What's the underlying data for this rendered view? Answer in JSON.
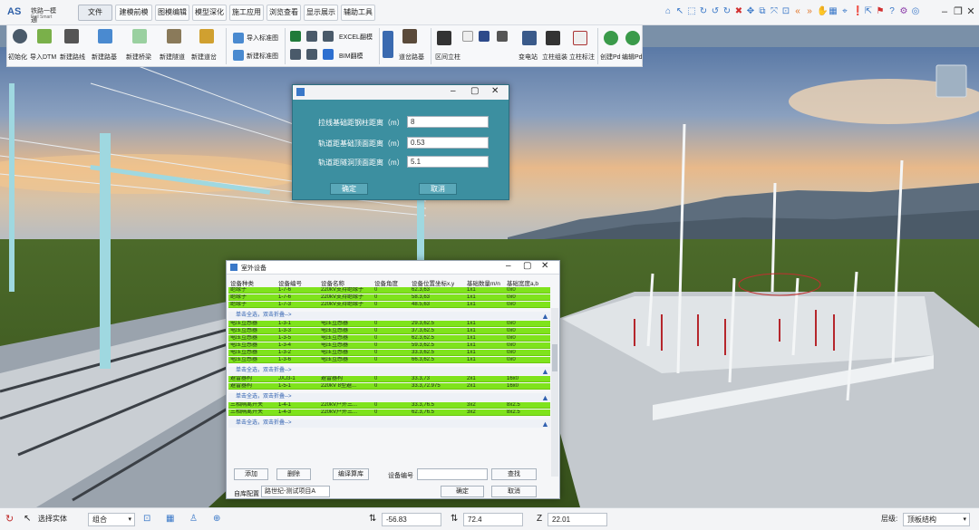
{
  "app": {
    "logo_mark": "AS",
    "logo_name": "铁路一模通",
    "logo_sub": "Rail Smart"
  },
  "menu": [
    "文件",
    "建模前模",
    "图模编辑",
    "模型深化",
    "施工应用",
    "浏览查看",
    "显示展示",
    "辅助工具"
  ],
  "ribbon": {
    "group1": [
      "初始化",
      "导入DTM",
      "新建路线",
      "新建路基",
      "新建桥梁",
      "新建隧道",
      "新建道岔"
    ],
    "group2": [
      "导入标准图",
      "新建标准图"
    ],
    "group3": [
      "EXCEL翻模",
      "BIM翻模"
    ],
    "group4": [
      "道岔路基"
    ],
    "group5": [
      "区间立柱",
      "变电站",
      "立柱组装",
      "立柱标注"
    ],
    "group6": [
      "创建Pd",
      "编辑Pd"
    ]
  },
  "dialog1": {
    "rows": [
      {
        "label": "拉线基础距钢柱距离（m）",
        "value": "8"
      },
      {
        "label": "轨道距基础顶面距离（m）",
        "value": "0.53"
      },
      {
        "label": "轨道距隧洞顶面距离（m）",
        "value": "5.1"
      }
    ],
    "ok": "确定",
    "cancel": "取消"
  },
  "dialog2": {
    "title": "室外设备",
    "headers": [
      "设备种类",
      "设备编号",
      "设备名称",
      "设备角度",
      "设备位置坐标x,y",
      "基础数量m/n",
      "基础宽度a,b"
    ],
    "groups": [
      {
        "header": "",
        "rows": [
          [
            "绝缘子",
            "1-7-6",
            "220kV支持绝缘子",
            "0",
            "62.3,63",
            "1x1",
            "0x0"
          ],
          [
            "绝缘子",
            "1-7-6",
            "220kV支持绝缘子",
            "0",
            "58.3,63",
            "1x1",
            "0x0"
          ],
          [
            "绝缘子",
            "1-7-3",
            "220kV支持绝缘子",
            "0",
            "48.5,63",
            "1x1",
            "0x0"
          ]
        ]
      },
      {
        "header": "单击全选，双击折叠-->",
        "rows": [
          [
            "电压互感器",
            "1-3-1",
            "电压互感器",
            "0",
            "29.3,62.5",
            "1x1",
            "0x0"
          ],
          [
            "电压互感器",
            "1-3-3",
            "电压互感器",
            "0",
            "37.3,62.5",
            "1x1",
            "0x0"
          ],
          [
            "电压互感器",
            "1-3-5",
            "电压互感器",
            "0",
            "62.3,62.5",
            "1x1",
            "0x0"
          ],
          [
            "电压互感器",
            "1-3-4",
            "电压互感器",
            "0",
            "59.3,62.5",
            "1x1",
            "0x0"
          ],
          [
            "电压互感器",
            "1-3-2",
            "电压互感器",
            "0",
            "33.3,62.5",
            "1x1",
            "0x0"
          ],
          [
            "电压互感器",
            "1-3-6",
            "电压互感器",
            "0",
            "66.3,62.5",
            "1x1",
            "0x0"
          ]
        ]
      },
      {
        "header": "单击全选，双击折叠-->",
        "rows": [
          [
            "避雷器构",
            "JXJ3-1",
            "避雷器构",
            "0",
            "33.3,73",
            "2x1",
            "16x0"
          ],
          [
            "避雷器构",
            "1-5-1",
            "220kV 8型避...",
            "0",
            "33.3,72.975",
            "2x1",
            "16x0"
          ]
        ]
      },
      {
        "header": "单击全选，双击折叠-->",
        "rows": [
          [
            "三相隔离开关",
            "1-4-1",
            "220kV户外三...",
            "0",
            "33.3,76.5",
            "3x2",
            "8x2.5"
          ],
          [
            "三相隔离开关",
            "1-4-3",
            "220kV户外三...",
            "0",
            "62.3,76.5",
            "3x2",
            "8x2.5"
          ]
        ]
      },
      {
        "header": "单击全选，双击折叠-->",
        "rows": []
      }
    ],
    "buttons": {
      "add": "添加",
      "delete": "删除",
      "compile": "编译算库",
      "code_label": "设备编号",
      "search": "查找",
      "config_label": "自库配置",
      "config_value": "路世纪-测试项目A",
      "ok": "确定",
      "cancel": "取消"
    }
  },
  "statusbar": {
    "select_entity": "选择实体",
    "combine": "组合",
    "x_value": "-56.83",
    "y_value": "72.4",
    "z_value": "22.01",
    "layer_label": "层级:",
    "layer_value": "顶板结构"
  }
}
